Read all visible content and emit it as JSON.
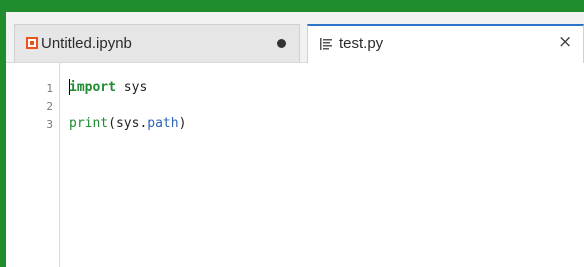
{
  "tabs": [
    {
      "label": "Untitled.ipynb",
      "icon": "notebook-icon",
      "dirty": true
    },
    {
      "label": "test.py",
      "icon": "file-lines-icon",
      "close": "×",
      "active": true
    }
  ],
  "editor": {
    "line_numbers": [
      "1",
      "2",
      "3"
    ],
    "lines": {
      "l1": {
        "kw": "import",
        "rest": " sys"
      },
      "l2": "",
      "l3": {
        "builtin": "print",
        "open": "(sys.",
        "attr": "path",
        "close": ")"
      }
    }
  },
  "colors": {
    "frame_green": "#1f8c2e",
    "active_tab_accent": "#2e75c9",
    "keyword": "#1e8c31",
    "attribute": "#2e65b8"
  }
}
